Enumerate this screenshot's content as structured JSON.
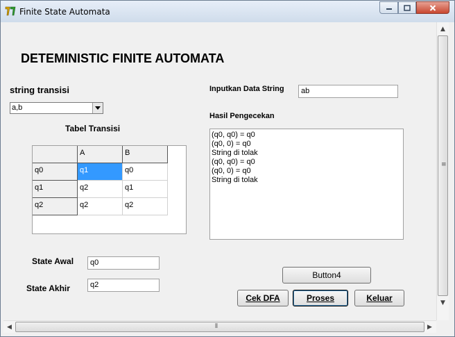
{
  "window": {
    "title": "Finite State Automata",
    "app_icon": "app-logo-icon",
    "controls": {
      "minimize_icon": "minimize-icon",
      "maximize_icon": "maximize-icon",
      "close_icon": "close-icon"
    }
  },
  "heading": "DETEMINISTIC FINITE AUTOMATA",
  "transition": {
    "label": "string transisi",
    "combo_value": "a,b",
    "table_title": "Tabel Transisi",
    "columns": [
      "",
      "A",
      "B"
    ],
    "rows": [
      [
        "q0",
        "q1",
        "q0"
      ],
      [
        "q1",
        "q2",
        "q1"
      ],
      [
        "q2",
        "q2",
        "q2"
      ]
    ]
  },
  "input_string": {
    "label": "Inputkan Data String",
    "value": "ab"
  },
  "result": {
    "label": "Hasil Pengecekan",
    "lines": [
      "(q0, q0) = q0",
      "(q0, 0) = q0",
      "String di tolak",
      "(q0, q0) = q0",
      "(q0, 0) = q0",
      "String di tolak"
    ]
  },
  "state_awal": {
    "label": "State Awal",
    "value": "q0"
  },
  "state_akhir": {
    "label": "State Akhir",
    "value": "q2"
  },
  "buttons": {
    "button4": "Button4",
    "cek_dfa": "Cek DFA",
    "proses": "Proses",
    "keluar": "Keluar"
  },
  "colors": {
    "selection": "#3399ff",
    "background": "#f0f0f0"
  }
}
